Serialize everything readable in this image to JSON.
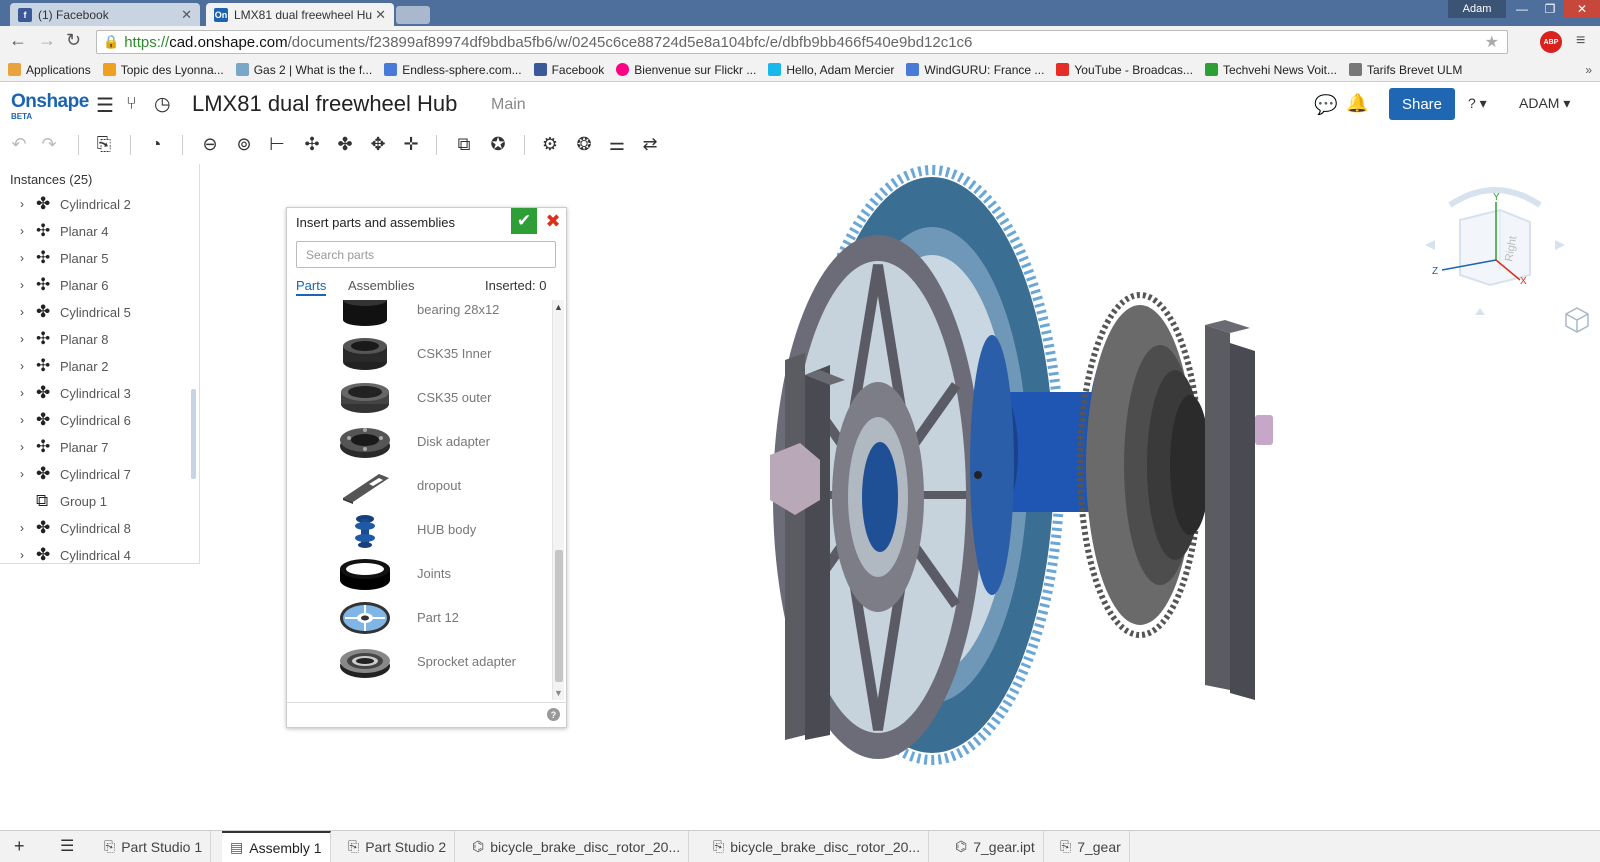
{
  "browser": {
    "tabs": [
      {
        "label": "(1) Facebook",
        "favicon": "facebook-icon",
        "active": false
      },
      {
        "label": "LMX81 dual freewheel Hu",
        "favicon": "onshape-icon",
        "favicon_text": "On",
        "active": true
      }
    ],
    "window_user": "Adam",
    "url": {
      "https": "https://",
      "host": "cad.onshape.com",
      "path": "/documents/f23899af89974df9bdba5fb6/w/0245c6ce88724d5e8a104bfc/e/dbfb9bb466f540e9bd12c1c6"
    },
    "abp_label": "ABP",
    "bookmarks": [
      {
        "label": "Applications",
        "color": "#e8a33d"
      },
      {
        "label": "Topic des Lyonna...",
        "color": "#f0a020"
      },
      {
        "label": "Gas 2 | What is the f...",
        "color": "#7aa6c8"
      },
      {
        "label": "Endless-sphere.com...",
        "color": "#4a7ad8"
      },
      {
        "label": "Facebook",
        "color": "#3b5998"
      },
      {
        "label": "Bienvenue sur Flickr ...",
        "color": "#ff0084"
      },
      {
        "label": "Hello, Adam Mercier",
        "color": "#1ab7ea"
      },
      {
        "label": "WindGURU: France ...",
        "color": "#4a7ad8"
      },
      {
        "label": "YouTube - Broadcas...",
        "color": "#e52d27"
      },
      {
        "label": "Techvehi News Voit...",
        "color": "#2e9e37"
      },
      {
        "label": "Tarifs Brevet ULM",
        "color": "#777777"
      }
    ]
  },
  "app": {
    "logo": "Onshape",
    "logo_beta": "BETA",
    "document_title": "LMX81 dual freewheel Hub",
    "workspace": "Main",
    "share_label": "Share",
    "user_label": "ADAM ▾",
    "help_label": "? ▾"
  },
  "instances": {
    "title": "Instances (25)",
    "items": [
      {
        "label": "Cylindrical 2",
        "type": "cylindrical"
      },
      {
        "label": "Planar 4",
        "type": "planar"
      },
      {
        "label": "Planar 5",
        "type": "planar"
      },
      {
        "label": "Planar 6",
        "type": "planar"
      },
      {
        "label": "Cylindrical 5",
        "type": "cylindrical"
      },
      {
        "label": "Planar 8",
        "type": "planar"
      },
      {
        "label": "Planar 2",
        "type": "planar"
      },
      {
        "label": "Cylindrical 3",
        "type": "cylindrical"
      },
      {
        "label": "Cylindrical 6",
        "type": "cylindrical"
      },
      {
        "label": "Planar 7",
        "type": "planar"
      },
      {
        "label": "Cylindrical 7",
        "type": "cylindrical"
      },
      {
        "label": "Group 1",
        "type": "group"
      },
      {
        "label": "Cylindrical 8",
        "type": "cylindrical"
      },
      {
        "label": "Cylindrical 4",
        "type": "cylindrical"
      }
    ]
  },
  "insert_dialog": {
    "title": "Insert parts and assemblies",
    "search_placeholder": "Search parts",
    "tabs": [
      "Parts",
      "Assemblies"
    ],
    "inserted_label": "Inserted: 0",
    "parts": [
      {
        "label": "bearing 28x12",
        "shape": "cylinder"
      },
      {
        "label": "CSK35 Inner",
        "shape": "ring-thick"
      },
      {
        "label": "CSK35 outer",
        "shape": "ring"
      },
      {
        "label": "Disk adapter",
        "shape": "adapter"
      },
      {
        "label": "dropout",
        "shape": "plate"
      },
      {
        "label": "HUB body",
        "shape": "hub"
      },
      {
        "label": "Joints",
        "shape": "ring-black"
      },
      {
        "label": "Part 12",
        "shape": "rotor"
      },
      {
        "label": "Sprocket adapter",
        "shape": "sprocket-adapter"
      }
    ]
  },
  "bottom_tabs": [
    {
      "label": "Part Studio 1",
      "icon": "part-studio-icon",
      "active": false
    },
    {
      "label": "Assembly 1",
      "icon": "assembly-icon",
      "active": true
    },
    {
      "label": "Part Studio 2",
      "icon": "part-studio-icon",
      "active": false
    },
    {
      "label": "bicycle_brake_disc_rotor_20...",
      "icon": "imported-icon",
      "active": false
    },
    {
      "label": "bicycle_brake_disc_rotor_20...",
      "icon": "part-studio-icon",
      "active": false
    },
    {
      "label": "7_gear.ipt",
      "icon": "imported-icon",
      "active": false
    },
    {
      "label": "7_gear",
      "icon": "part-studio-icon",
      "active": false
    }
  ],
  "viewcube": {
    "face_label": "Right",
    "axis_x": "X",
    "axis_y": "Y",
    "axis_z": "Z"
  },
  "colors": {
    "accent": "#1a64b0",
    "ok": "#2e9e37",
    "cancel": "#d9311d"
  }
}
